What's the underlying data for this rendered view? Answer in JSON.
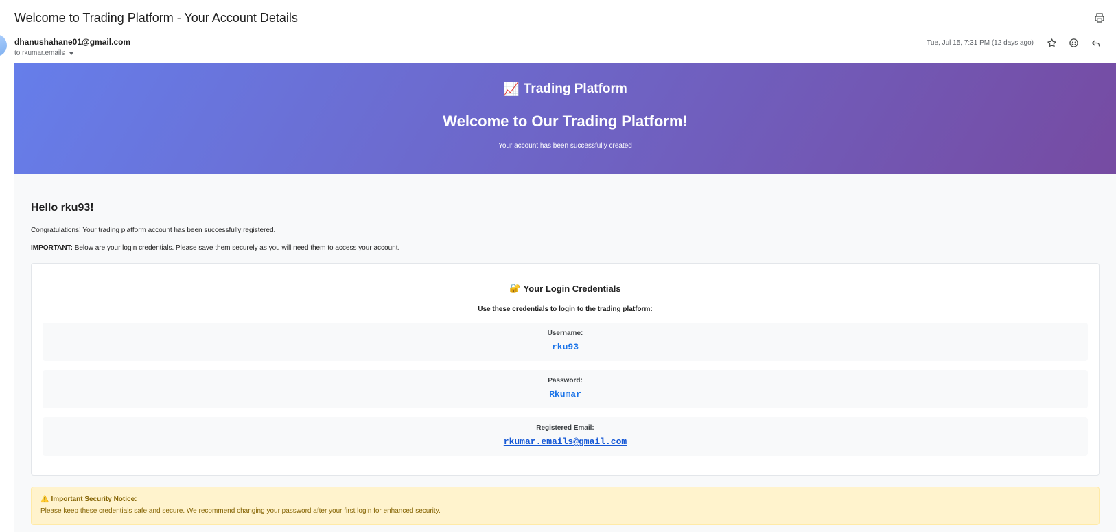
{
  "subject": "Welcome to Trading Platform - Your Account Details",
  "header": {
    "sender": "dhanushahane01@gmail.com",
    "recipient": "to rkumar.emails",
    "date": "Tue, Jul 15, 7:31 PM (12 days ago)",
    "icons": [
      "print-icon",
      "star-icon",
      "emoji-icon",
      "reply-icon"
    ]
  },
  "email": {
    "hero": {
      "brand_emoji": "📈",
      "brand": "Trading Platform",
      "welcome": "Welcome to Our Trading Platform!",
      "subtitle": "Your account has been successfully created"
    },
    "greeting": "Hello rku93!",
    "congrats": "Congratulations! Your trading platform account has been successfully registered.",
    "important_label": "IMPORTANT:",
    "important_text": " Below are your login credentials. Please save them securely as you will need them to access your account.",
    "credentials": {
      "emoji": "🔐",
      "title": "Your Login Credentials",
      "subtitle": "Use these credentials to login to the trading platform:",
      "items": [
        {
          "label": "Username:",
          "value": "rku93"
        },
        {
          "label": "Password:",
          "value": "Rkumar"
        },
        {
          "label": "Registered Email:",
          "value": "rkumar.emails@gmail.com"
        }
      ]
    },
    "notice": {
      "emoji": "⚠️",
      "title": "Important Security Notice:",
      "text": "Please keep these credentials safe and secure. We recommend changing your password after your first login for enhanced security."
    }
  },
  "colors": {
    "hero_start": "#667eea",
    "hero_end": "#764ba2",
    "credential_value": "#1a73e8",
    "notice_bg": "#fff3cd",
    "notice_text": "#856404"
  }
}
